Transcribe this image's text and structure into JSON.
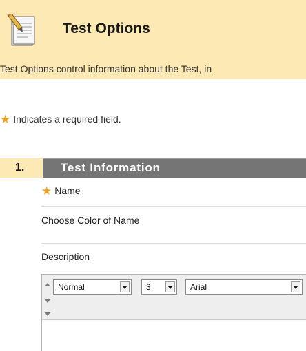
{
  "header": {
    "title": "Test Options",
    "icon": "document-edit-icon",
    "intro": "Test Options control information about the Test, in"
  },
  "legend": {
    "required_note": "Indicates a required field.",
    "star": "★"
  },
  "section": {
    "number": "1.",
    "title": "Test Information"
  },
  "fields": {
    "name_label": "Name",
    "color_label": "Choose Color of Name",
    "description_label": "Description"
  },
  "editor": {
    "format_value": "Normal",
    "size_value": "3",
    "font_value": "Arial"
  },
  "colors": {
    "header_bg": "#fde9b4",
    "section_bar": "#757575",
    "required_star": "#f5a21b"
  }
}
